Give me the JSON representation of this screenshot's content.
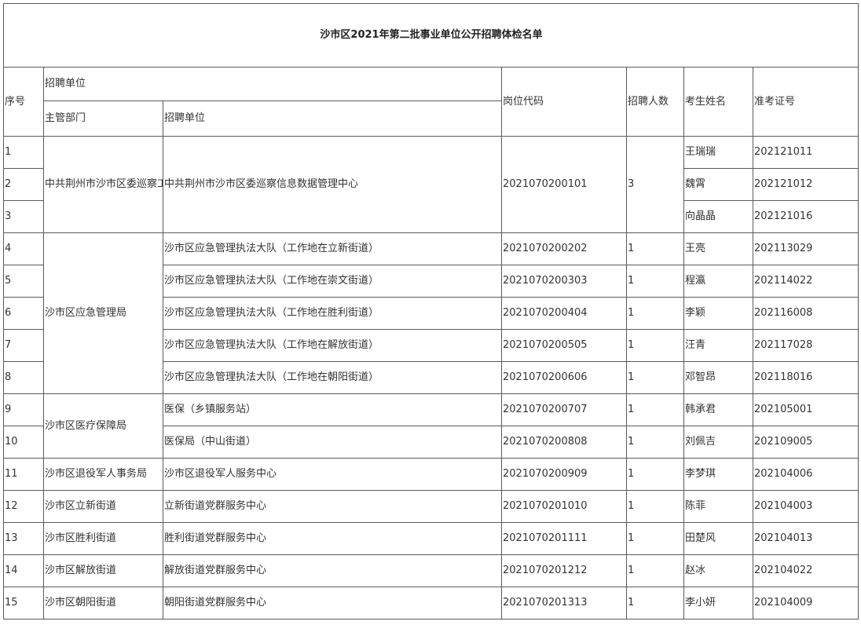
{
  "title": "沙市区2021年第二批事业单位公开招聘体检名单",
  "headers": {
    "seq": "序号",
    "recruit_group": "招聘单位",
    "dept": "主管部门",
    "unit": "招聘单位",
    "post_code": "岗位代码",
    "count": "招聘人数",
    "name": "考生姓名",
    "ticket": "准考证号"
  },
  "rows": [
    {
      "seq": "1",
      "dept": "中共荆州市沙市区委巡察工作领导小组办公室",
      "unit": "中共荆州市沙市区委巡察信息数据管理中心",
      "post_code": "2021070200101",
      "count": "3",
      "name": "王瑞瑞",
      "ticket": "202121011"
    },
    {
      "seq": "2",
      "name": "魏霄",
      "ticket": "202121012"
    },
    {
      "seq": "3",
      "name": "向晶晶",
      "ticket": "202121016"
    },
    {
      "seq": "4",
      "dept": "沙市区应急管理局",
      "unit": "沙市区应急管理执法大队（工作地在立新街道）",
      "post_code": "2021070200202",
      "count": "1",
      "name": "王亮",
      "ticket": "202113029"
    },
    {
      "seq": "5",
      "unit": "沙市区应急管理执法大队（工作地在崇文街道）",
      "post_code": "2021070200303",
      "count": "1",
      "name": "程瀛",
      "ticket": "202114022"
    },
    {
      "seq": "6",
      "unit": "沙市区应急管理执法大队（工作地在胜利街道）",
      "post_code": "2021070200404",
      "count": "1",
      "name": "李颖",
      "ticket": "202116008"
    },
    {
      "seq": "7",
      "unit": "沙市区应急管理执法大队（工作地在解放街道）",
      "post_code": "2021070200505",
      "count": "1",
      "name": "汪青",
      "ticket": "202117028"
    },
    {
      "seq": "8",
      "unit": "沙市区应急管理执法大队（工作地在朝阳街道）",
      "post_code": "2021070200606",
      "count": "1",
      "name": "邓智昂",
      "ticket": "202118016"
    },
    {
      "seq": "9",
      "dept": "沙市区医疗保障局",
      "unit": "医保（乡镇服务站）",
      "post_code": "2021070200707",
      "count": "1",
      "name": "韩承君",
      "ticket": "202105001"
    },
    {
      "seq": "10",
      "unit": "医保局（中山街道）",
      "post_code": "2021070200808",
      "count": "1",
      "name": "刘佩吉",
      "ticket": "202109005"
    },
    {
      "seq": "11",
      "dept": "沙市区退役军人事务局",
      "unit": "沙市区退役军人服务中心",
      "post_code": "2021070200909",
      "count": "1",
      "name": "李梦琪",
      "ticket": "202104006"
    },
    {
      "seq": "12",
      "dept": "沙市区立新街道",
      "unit": "立新街道党群服务中心",
      "post_code": "2021070201010",
      "count": "1",
      "name": "陈菲",
      "ticket": "202104003"
    },
    {
      "seq": "13",
      "dept": "沙市区胜利街道",
      "unit": "胜利街道党群服务中心",
      "post_code": "2021070201111",
      "count": "1",
      "name": "田楚风",
      "ticket": "202104013"
    },
    {
      "seq": "14",
      "dept": "沙市区解放街道",
      "unit": "解放街道党群服务中心",
      "post_code": "2021070201212",
      "count": "1",
      "name": "赵冰",
      "ticket": "202104022"
    },
    {
      "seq": "15",
      "dept": "沙市区朝阳街道",
      "unit": "朝阳街道党群服务中心",
      "post_code": "2021070201313",
      "count": "1",
      "name": "李小妍",
      "ticket": "202104009"
    }
  ]
}
